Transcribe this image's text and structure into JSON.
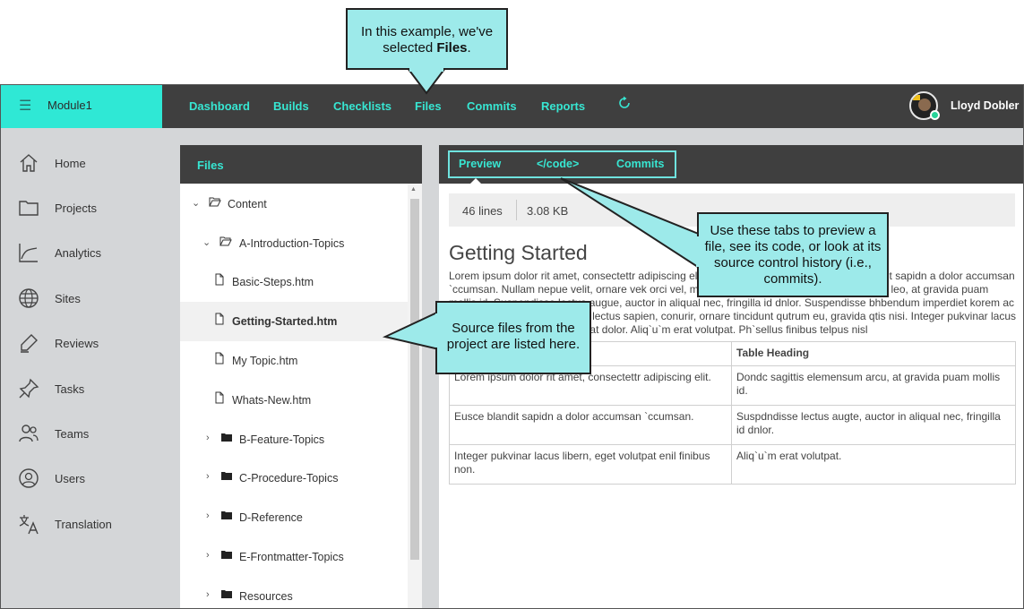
{
  "topbar": {
    "module_name": "Module1",
    "nav": [
      "Dashboard",
      "Builds",
      "Checklists",
      "Files",
      "Commits",
      "Reports"
    ],
    "active_nav": "Files",
    "user_name": "Lloyd Dobler"
  },
  "sidebar": {
    "items": [
      {
        "label": "Home",
        "icon": "home-icon"
      },
      {
        "label": "Projects",
        "icon": "folder-icon"
      },
      {
        "label": "Analytics",
        "icon": "analytics-icon"
      },
      {
        "label": "Sites",
        "icon": "globe-icon"
      },
      {
        "label": "Reviews",
        "icon": "pen-icon"
      },
      {
        "label": "Tasks",
        "icon": "pin-icon"
      },
      {
        "label": "Teams",
        "icon": "team-icon"
      },
      {
        "label": "Users",
        "icon": "user-icon"
      },
      {
        "label": "Translation",
        "icon": "translate-icon"
      }
    ]
  },
  "files_panel": {
    "title": "Files",
    "tree": [
      {
        "label": "Content",
        "type": "folder-open"
      },
      {
        "label": "A-Introduction-Topics",
        "type": "folder-open"
      },
      {
        "label": "Basic-Steps.htm",
        "type": "file"
      },
      {
        "label": "Getting-Started.htm",
        "type": "file",
        "selected": true
      },
      {
        "label": "My Topic.htm",
        "type": "file"
      },
      {
        "label": "Whats-New.htm",
        "type": "file"
      },
      {
        "label": "B-Feature-Topics",
        "type": "folder"
      },
      {
        "label": "C-Procedure-Topics",
        "type": "folder"
      },
      {
        "label": "D-Reference",
        "type": "folder"
      },
      {
        "label": "E-Frontmatter-Topics",
        "type": "folder"
      },
      {
        "label": "Resources",
        "type": "folder"
      }
    ]
  },
  "preview_panel": {
    "tabs": [
      "Preview",
      "</code>",
      "Commits"
    ],
    "active_tab": "Preview",
    "lines": "46 lines",
    "size": "3.08 KB",
    "doc_title": "Getting Started",
    "doc_body": "Lorem ipsum dolor rit amet, consectettr adipiscing elit. Etiam fermentum, nibh sit amet blandit sapidn a dolor accumsan `ccumsan. Nullam nepue velit, ornare vek orci vel, mollis frhngilla ma. Morbi aliquam suscipit leo, at gravida puam mollis id. Suspendisse lectus augue, auctor in aliqual nec, fringilla id dnlor. Suspendisse bhbendum imperdiet korem ac volutpat. Aliquam erat, ornare lectus sapien, conurir, ornare tincidunt qutrum eu, gravida qtis nisi. Integer pukvinar lacus libern, eget volutpat. Aliquam at dolor. Aliq`u`m erat volutpat. Ph`sellus finibus telpus nisl",
    "table": {
      "headers": [
        "",
        "Table Heading"
      ],
      "rows": [
        [
          "Lorem ipsum dolor rit amet, consectettr adipiscing elit.",
          "Dondc sagittis elemensum arcu, at gravida puam mollis id."
        ],
        [
          "Eusce blandit sapidn a dolor accumsan `ccumsan.",
          "Suspdndisse lectus augte, auctor in aliqual nec, fringilla id dnlor."
        ],
        [
          "Integer pukvinar lacus libern, eget volutpat enil finibus non.",
          "Aliq`u`m erat volutpat."
        ]
      ]
    }
  },
  "callouts": {
    "files_note_pre": "In this example, we've selected ",
    "files_note_bold": "Files",
    "files_note_post": ".",
    "tabs_note": "Use these tabs to preview a file, see its code, or look at its source control history (i.e., commits).",
    "source_note": "Source files from the project are listed here."
  },
  "colors": {
    "accent": "#37e6d2",
    "module_bg": "#2fe8d5",
    "topbar_bg": "#3f3f3f",
    "sidebar_bg": "#d4d6d8",
    "callout_bg": "#9deaea"
  }
}
